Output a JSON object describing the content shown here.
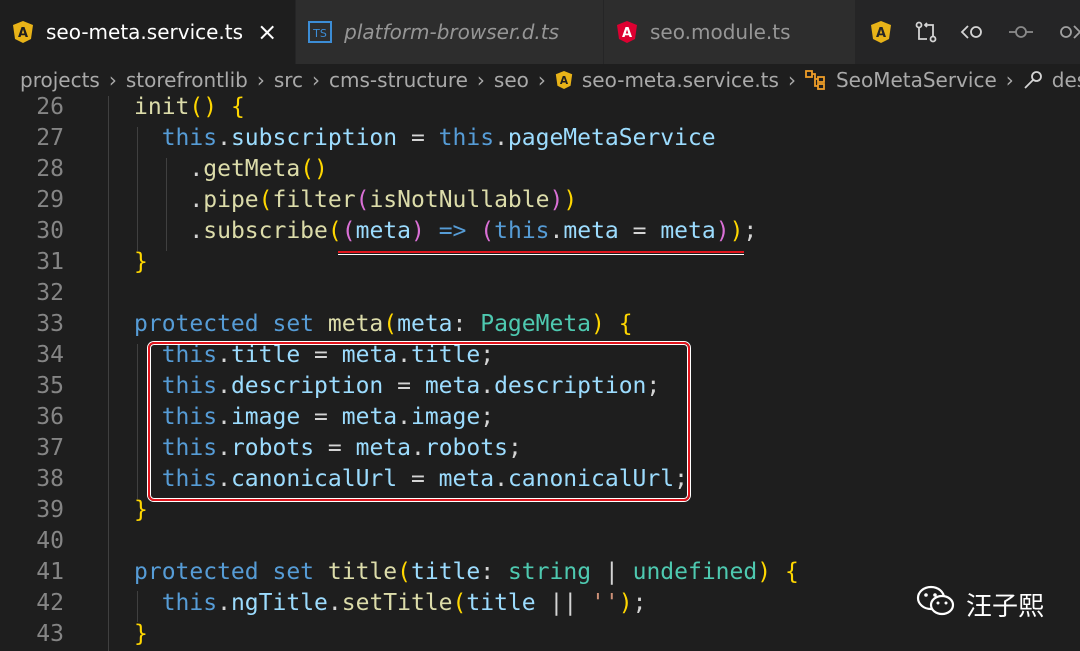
{
  "tabs": [
    {
      "label": "seo-meta.service.ts",
      "icon": "angular-icon",
      "active": true
    },
    {
      "label": "platform-browser.d.ts",
      "icon": "typescript-icon",
      "badge": "TS",
      "active": false
    },
    {
      "label": "seo.module.ts",
      "icon": "angular-icon",
      "active": false
    }
  ],
  "tab_close_glyph": "×",
  "breadcrumb": [
    "projects",
    "storefrontlib",
    "src",
    "cms-structure",
    "seo",
    "seo-meta.service.ts",
    "SeoMetaService",
    "descripti"
  ],
  "line_numbers": [
    "26",
    "27",
    "28",
    "29",
    "30",
    "31",
    "32",
    "33",
    "34",
    "35",
    "36",
    "37",
    "38",
    "39",
    "40",
    "41",
    "42",
    "43"
  ],
  "code_lines": [
    "init() {",
    "  this.subscription = this.pageMetaService",
    "    .getMeta()",
    "    .pipe(filter(isNotNullable))",
    "    .subscribe((meta) => (this.meta = meta));",
    "}",
    "",
    "protected set meta(meta: PageMeta) {",
    "  this.title = meta.title;",
    "  this.description = meta.description;",
    "  this.image = meta.image;",
    "  this.robots = meta.robots;",
    "  this.canonicalUrl = meta.canonicalUrl;",
    "}",
    "",
    "protected set title(title: string | undefined) {",
    "  this.ngTitle.setTitle(title || '');",
    "}"
  ],
  "watermark": "汪子熙",
  "colors": {
    "highlight": "#e1141c",
    "angular": "#dd0031",
    "ts": "#3178c6"
  }
}
